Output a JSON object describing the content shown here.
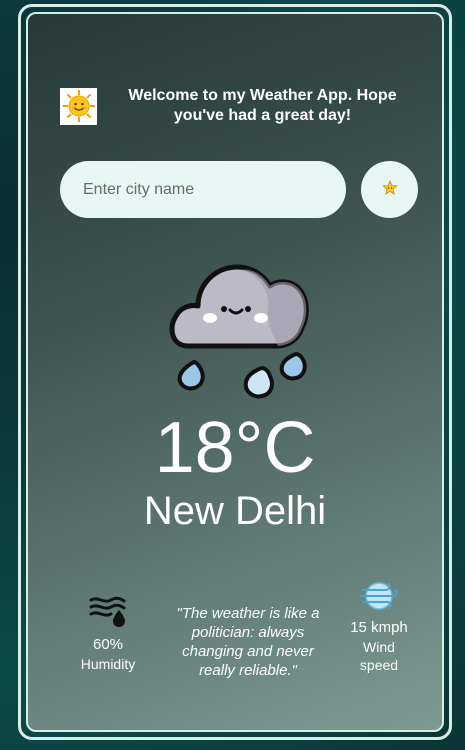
{
  "header": {
    "icon": "sun-face-icon",
    "welcome_text": "Welcome to my Weather App. Hope you've had a great day!"
  },
  "search": {
    "placeholder": "Enter city name",
    "value": "",
    "button_icon": "star-icon"
  },
  "weather": {
    "icon": "rain-cloud-icon",
    "temperature": "18°C",
    "city": "New Delhi"
  },
  "stats": {
    "humidity": {
      "icon": "humidity-icon",
      "value": "60%",
      "label": "Humidity"
    },
    "quote": "\"The weather is like a politician: always changing and never really reliable.\"",
    "wind": {
      "icon": "wind-icon",
      "value": "15 kmph",
      "label": "Wind speed"
    }
  },
  "colors": {
    "accent_light": "#e6f7f4",
    "border": "#d9ece8",
    "text": "#ffffff"
  }
}
